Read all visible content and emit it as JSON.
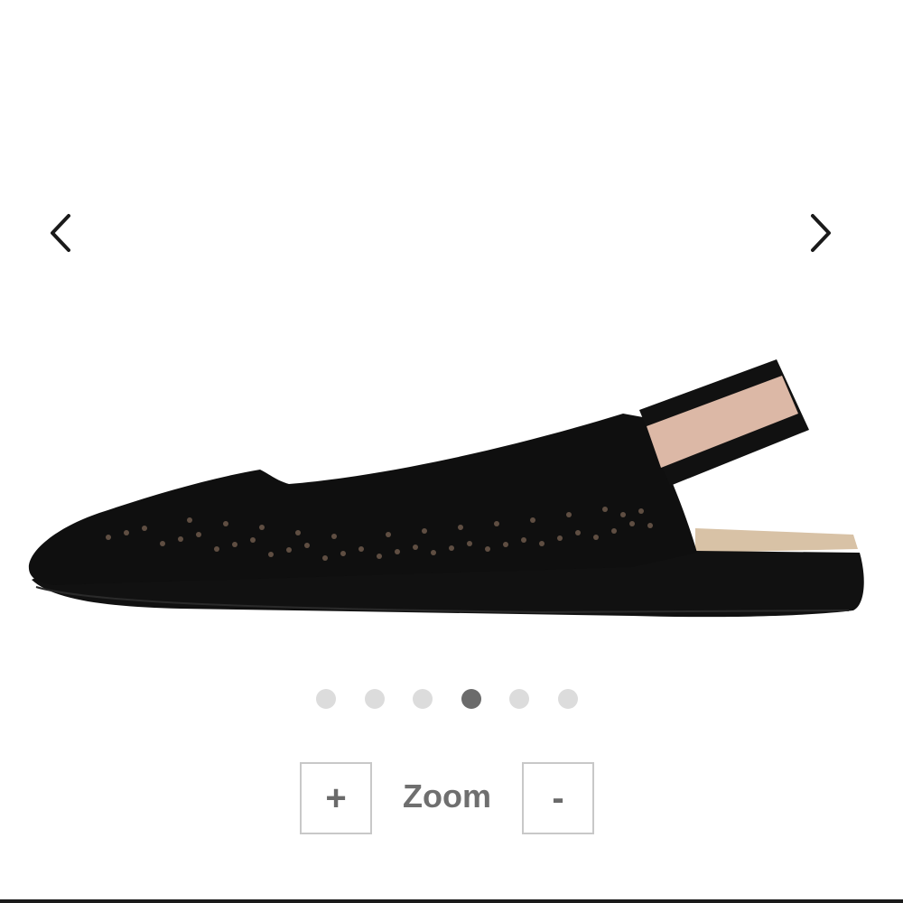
{
  "gallery": {
    "prev_icon": "chevron-left-icon",
    "next_icon": "chevron-right-icon",
    "image_alt_icon": "product-shoe-image",
    "slide_count": 6,
    "active_slide": 4
  },
  "zoom": {
    "in_label": "+",
    "label": "Zoom",
    "out_label": "-"
  },
  "colors": {
    "arrow": "#1a1a1a",
    "dot_inactive": "#dcdcdc",
    "dot_active": "#6b6b6b",
    "zoom_text": "#6f6f6f",
    "zoom_border": "#c8c8c8"
  }
}
